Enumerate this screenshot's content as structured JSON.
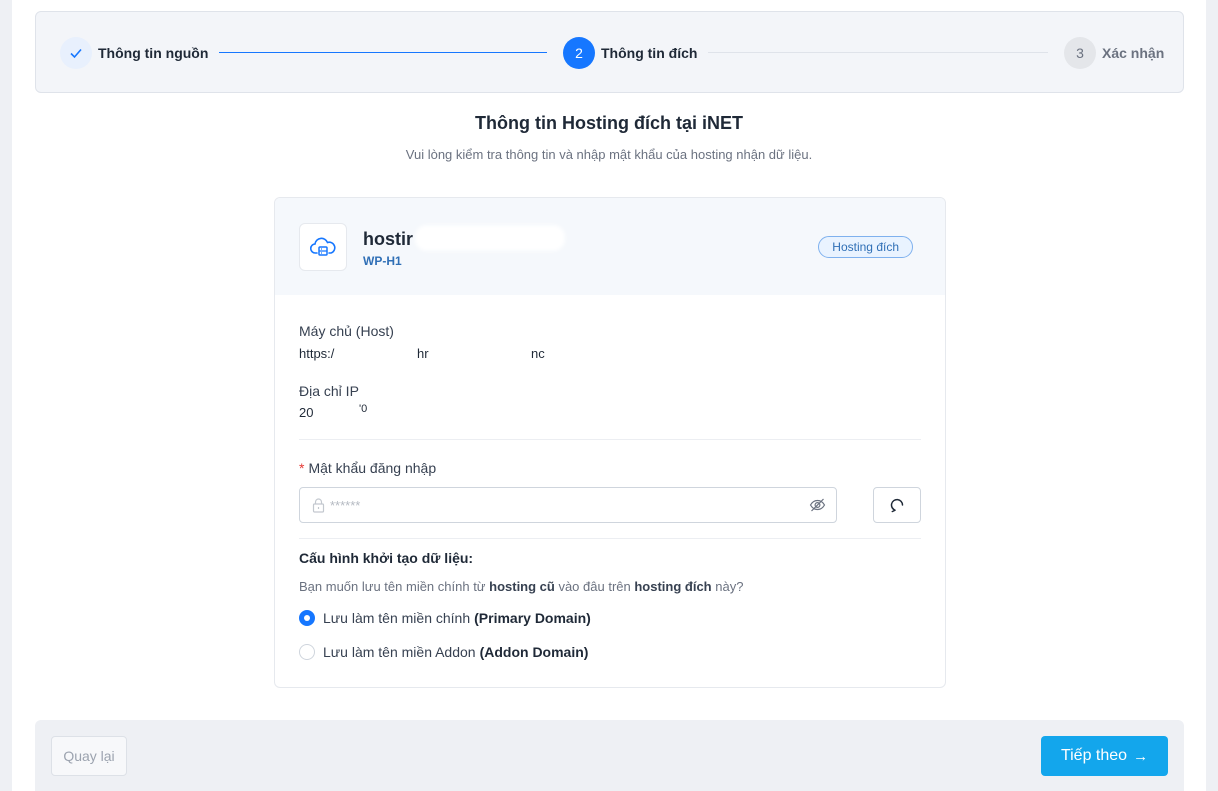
{
  "stepper": {
    "steps": [
      {
        "number": "",
        "label": "Thông tin nguồn",
        "state": "done"
      },
      {
        "number": "2",
        "label": "Thông tin đích",
        "state": "active"
      },
      {
        "number": "3",
        "label": "Xác nhận",
        "state": "pending"
      }
    ]
  },
  "header": {
    "title": "Thông tin Hosting đích tại iNET",
    "subtitle": "Vui lòng kiểm tra thông tin và nhập mật khẩu của hosting nhận dữ liệu."
  },
  "hosting": {
    "name": "hostir",
    "plan": "WP-H1",
    "badge": "Hosting đích"
  },
  "fields": {
    "host_label": "Máy chủ (Host)",
    "host_value": "https:/",
    "host_value_mid": "hr",
    "host_value_end": "nc",
    "ip_label": "Địa chỉ IP",
    "ip_value": "20",
    "ip_value_end": "'0"
  },
  "password": {
    "label": "Mật khẩu đăng nhập",
    "placeholder": "******"
  },
  "config": {
    "title": "Cấu hình khởi tạo dữ liệu:",
    "desc_part1": "Bạn muốn lưu tên miền chính từ ",
    "desc_bold1": "hosting cũ",
    "desc_part2": " vào đâu trên ",
    "desc_bold2": "hosting đích",
    "desc_part3": " này?",
    "options": [
      {
        "label": "Lưu làm tên miền chính",
        "bold": "(Primary Domain)",
        "checked": true
      },
      {
        "label": "Lưu làm tên miền Addon",
        "bold": "(Addon Domain)",
        "checked": false
      }
    ]
  },
  "footer": {
    "back_label": "Quay lại",
    "next_label": "Tiếp theo",
    "next_arrow": "→"
  },
  "colors": {
    "primary": "#1677ff",
    "next_button": "#13a6ec",
    "badge": "#2f6fb6"
  }
}
